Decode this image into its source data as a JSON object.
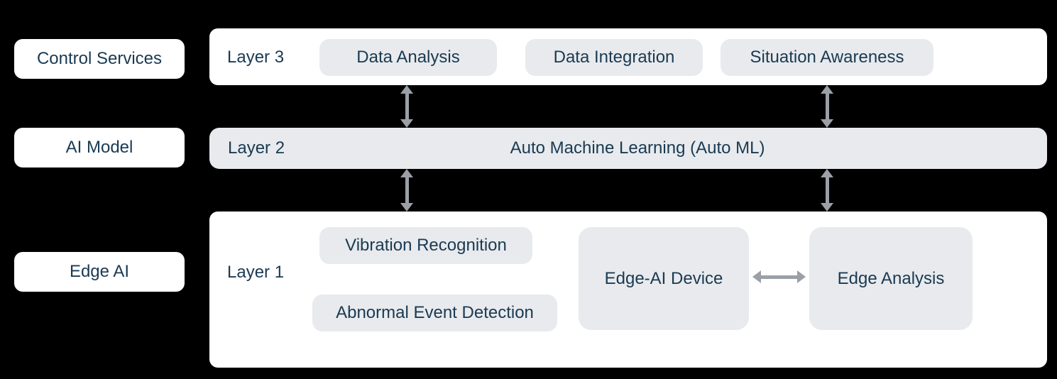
{
  "sideLabels": {
    "controlServices": "Control Services",
    "aiModel": "AI Model",
    "edgeAi": "Edge AI"
  },
  "layers": {
    "layer3": "Layer 3",
    "layer2": "Layer 2",
    "layer1": "Layer 1"
  },
  "layer3Items": {
    "dataAnalysis": "Data Analysis",
    "dataIntegration": "Data Integration",
    "situationAwareness": "Situation Awareness"
  },
  "layer2Items": {
    "autoML": "Auto Machine Learning (Auto ML)"
  },
  "layer1Items": {
    "vibrationRecognition": "Vibration Recognition",
    "abnormalEventDetection": "Abnormal Event Detection",
    "edgeAiDevice": "Edge-AI Device",
    "edgeAnalysis": "Edge Analysis"
  }
}
